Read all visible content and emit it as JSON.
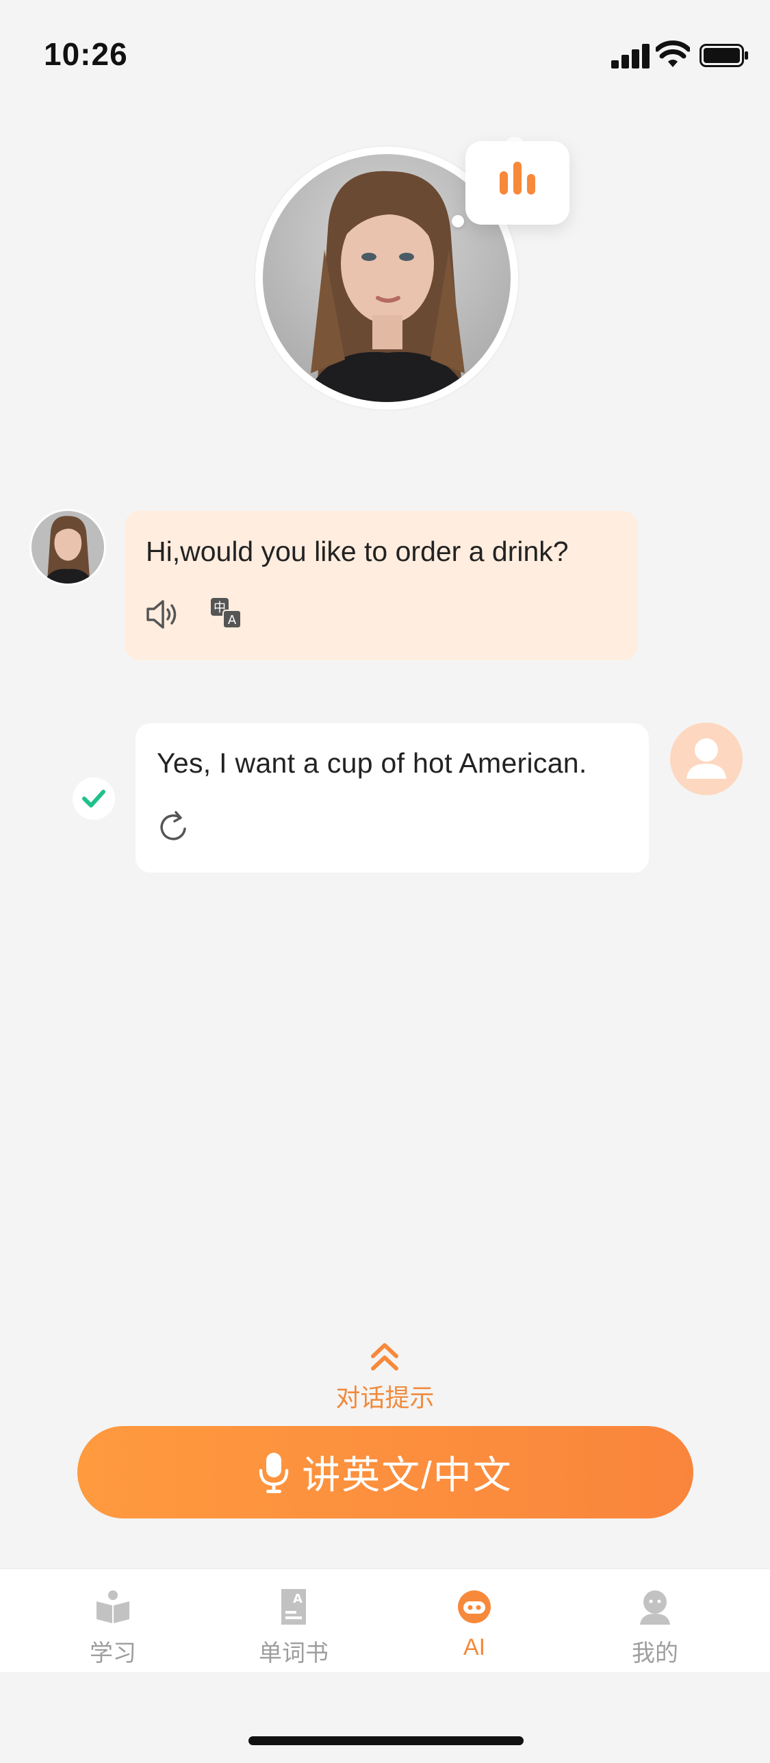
{
  "status_bar": {
    "time": "10:26"
  },
  "assistant": {
    "portrait": "woman-portrait-avatar",
    "voice_icon": "sound-bars-icon"
  },
  "messages": [
    {
      "role": "ai",
      "text": "Hi,would you like to order a drink?",
      "icons": [
        "speaker-icon",
        "translate-icon"
      ]
    },
    {
      "role": "user",
      "text": "Yes, I want a cup of hot American.",
      "icons": [
        "retry-icon",
        "check-icon"
      ]
    }
  ],
  "hint": {
    "label": "对话提示",
    "icon": "chevron-double-up-icon"
  },
  "speak_button": {
    "label": "讲英文/中文",
    "icon": "microphone-icon"
  },
  "tabs": [
    {
      "label": "学习",
      "icon": "book-icon",
      "active": false
    },
    {
      "label": "单词书",
      "icon": "wordbook-icon",
      "active": false
    },
    {
      "label": "AI",
      "icon": "robot-icon",
      "active": true
    },
    {
      "label": "我的",
      "icon": "profile-icon",
      "active": false
    }
  ],
  "colors": {
    "accent": "#f7893b",
    "ai_bubble": "#ffeddf",
    "check": "#20c08a"
  }
}
